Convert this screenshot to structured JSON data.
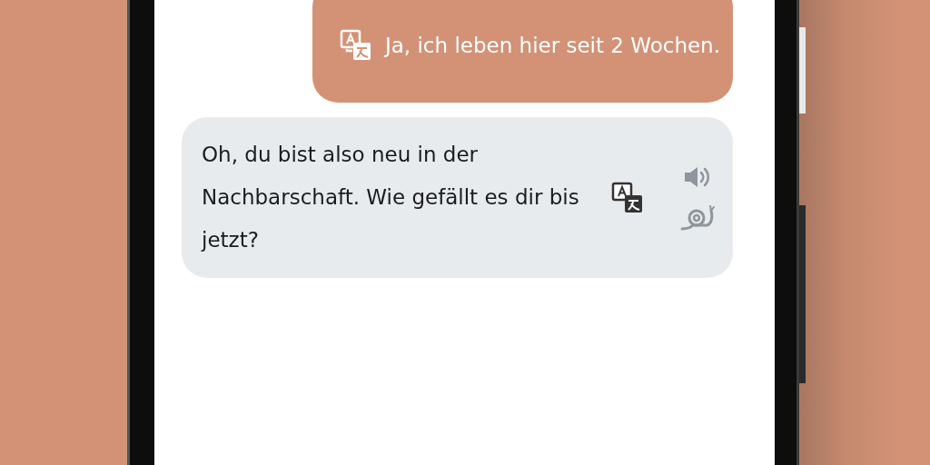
{
  "messages": [
    {
      "kind": "user",
      "text": "Ja, ich leben hier seit 2 Wochen."
    },
    {
      "kind": "partner",
      "text": "Oh, du bist also neu in der Nachbarschaft. Wie gefällt es dir bis jetzt?"
    }
  ]
}
